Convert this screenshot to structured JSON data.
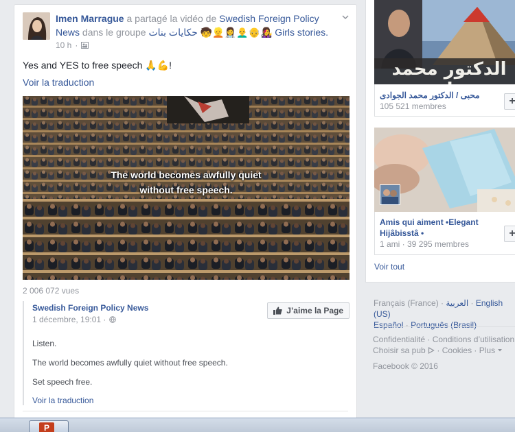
{
  "post": {
    "author": "Imen Marrague",
    "shared_text": "a partagé la vidéo de",
    "page_name_1": "Swedish Foreign Policy",
    "page_name_2": "News",
    "in_group": "dans le groupe",
    "group_name_arabic": "حكايات بنات",
    "group_emojis": "🧒👱👩‍⚕️👨‍🦲👴👩‍🎤",
    "group_name_suffix": "Girls stories.",
    "time": "10 h",
    "text": "Yes and YES to free speech 🙏💪!",
    "see_translation": "Voir la traduction",
    "video_caption_line1": "The world becomes awfully quiet",
    "video_caption_line2": "without free speech.",
    "views": "2 006 072 vues"
  },
  "shared_post": {
    "page_name": "Swedish Foreign Policy News",
    "date": "1 décembre, 19:01 ·",
    "like_page_label": "J’aime la Page",
    "lines": [
      "Listen.",
      "The world becomes awfully quiet without free speech.",
      "Set speech free."
    ],
    "see_translation": "Voir la traduction"
  },
  "groups": [
    {
      "thumb_text": "الدكتور محمد جوادي",
      "name": "محبى / الدكتور محمد الجوادى",
      "members": "105 521 membres",
      "join_label": "+"
    },
    {
      "name": "Amis qui aiment •Elegant Hijâbisstâ •",
      "members": "1 ami · 39 295 membres",
      "join_label": "+"
    }
  ],
  "see_all": "Voir tout",
  "languages": {
    "current": "Français (France) ·",
    "arabic": "العربية",
    "english": "English (US)",
    "spanish": "Español",
    "portuguese": "Português (Brasil)"
  },
  "footer": {
    "privacy": "Confidentialité",
    "terms": "Conditions d’utilisation",
    "ad_choices": "Choisir sa pub",
    "cookies": "Cookies",
    "more": "Plus",
    "copyright": "Facebook © 2016"
  },
  "taskbar": {
    "app_letter": "P"
  }
}
